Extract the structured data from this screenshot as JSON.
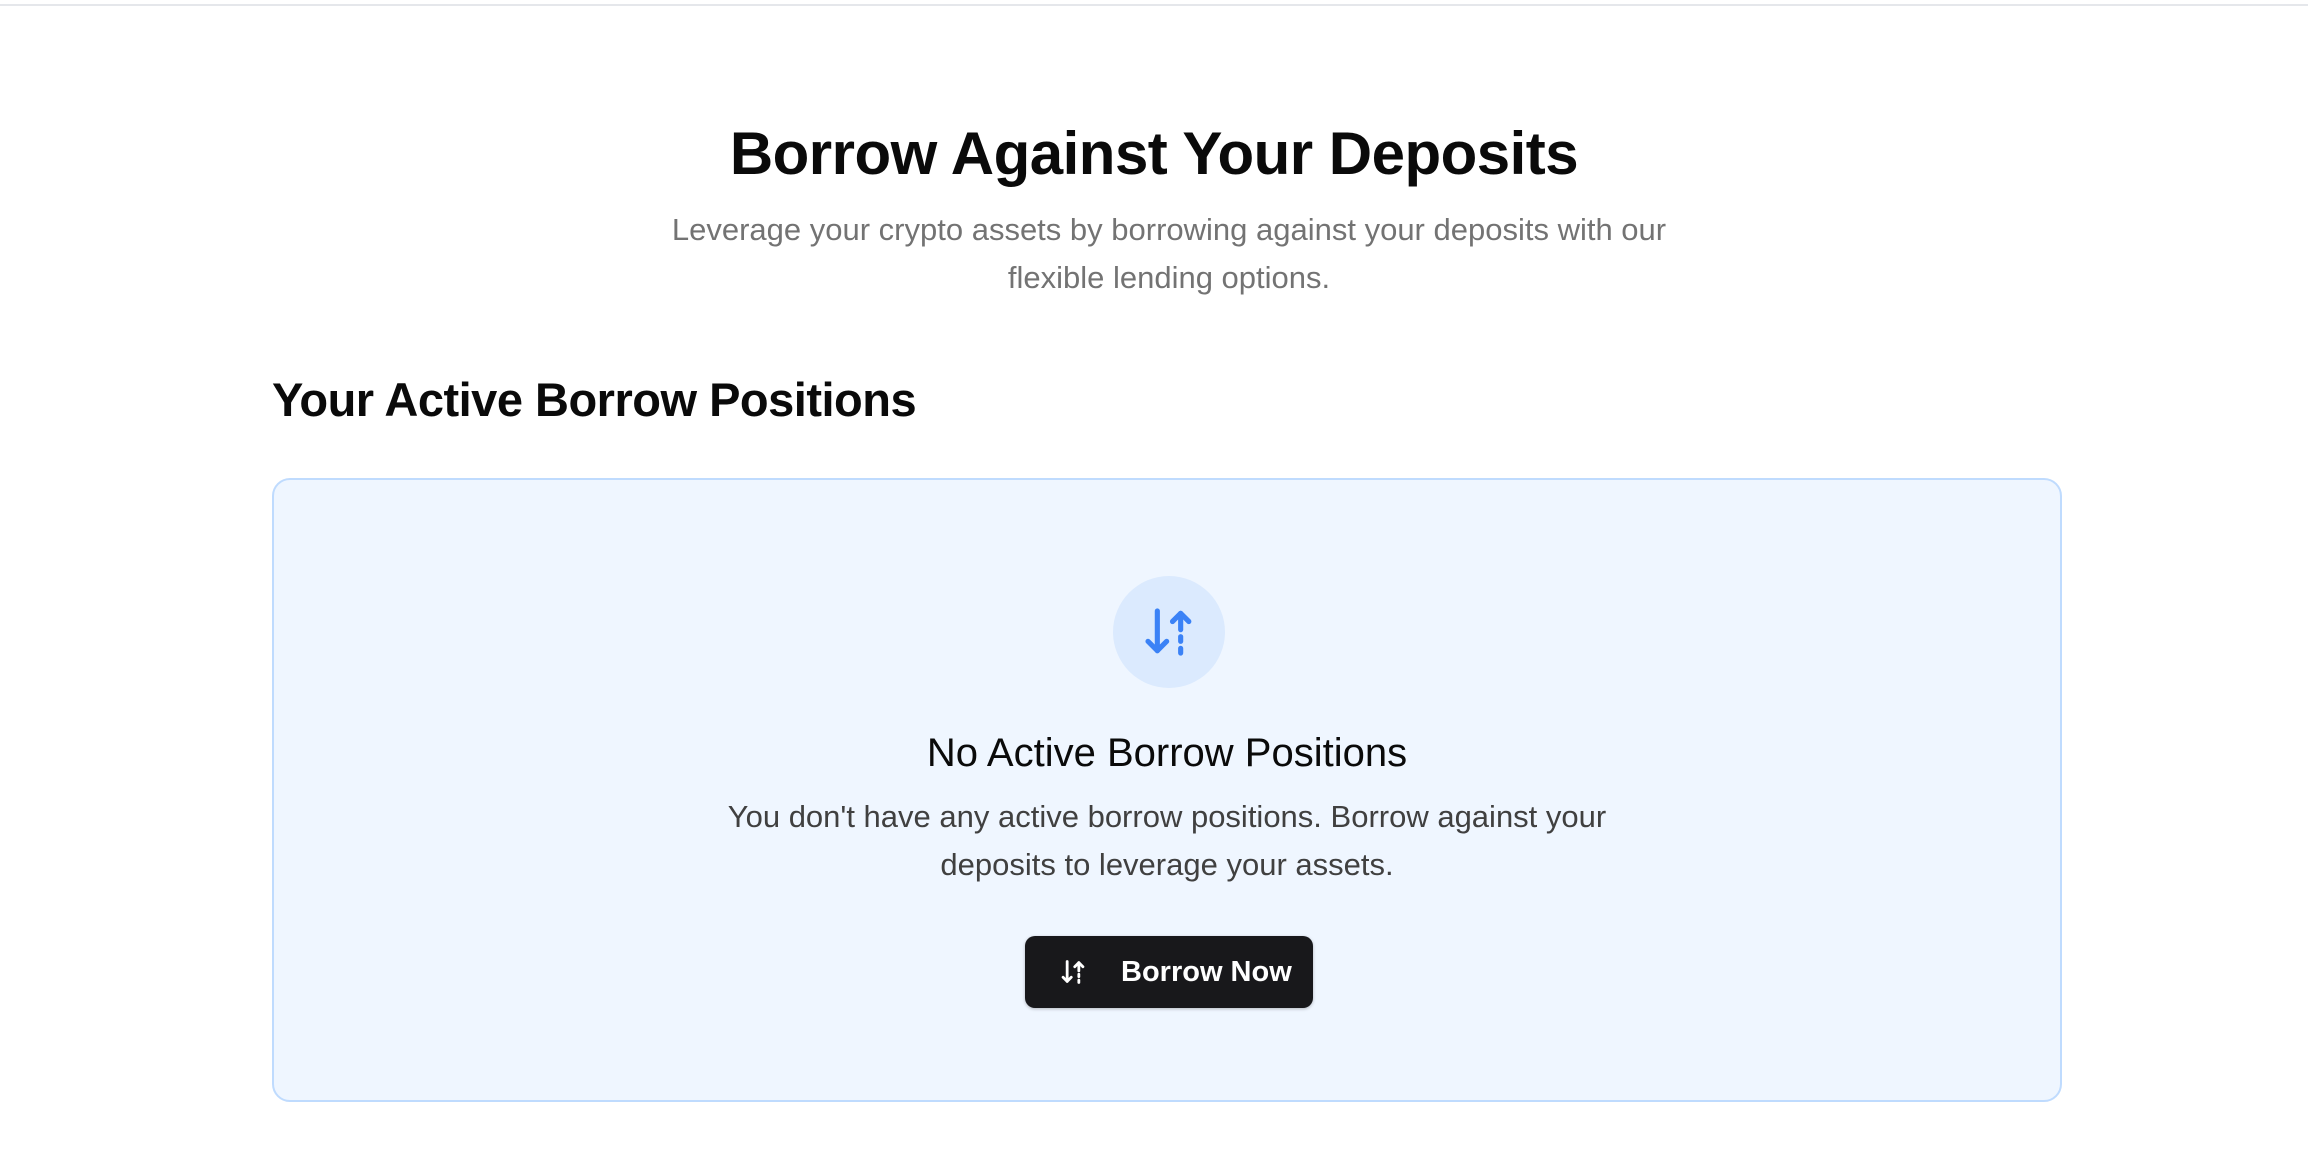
{
  "hero": {
    "title": "Borrow Against Your Deposits",
    "subtitle": "Leverage your crypto assets by borrowing against your deposits with our flexible lending options."
  },
  "positions": {
    "heading": "Your Active Borrow Positions",
    "empty_state": {
      "icon": "arrow-down-up-icon",
      "title": "No Active Borrow Positions",
      "description": "You don't have any active borrow positions. Borrow against your deposits to leverage your assets.",
      "button_label": "Borrow Now",
      "button_icon": "arrow-down-up-icon"
    }
  },
  "colors": {
    "accent": "#3b82f6",
    "card_background": "#eff6ff",
    "card_border": "#bfdbfe",
    "button_background": "#18181b"
  }
}
